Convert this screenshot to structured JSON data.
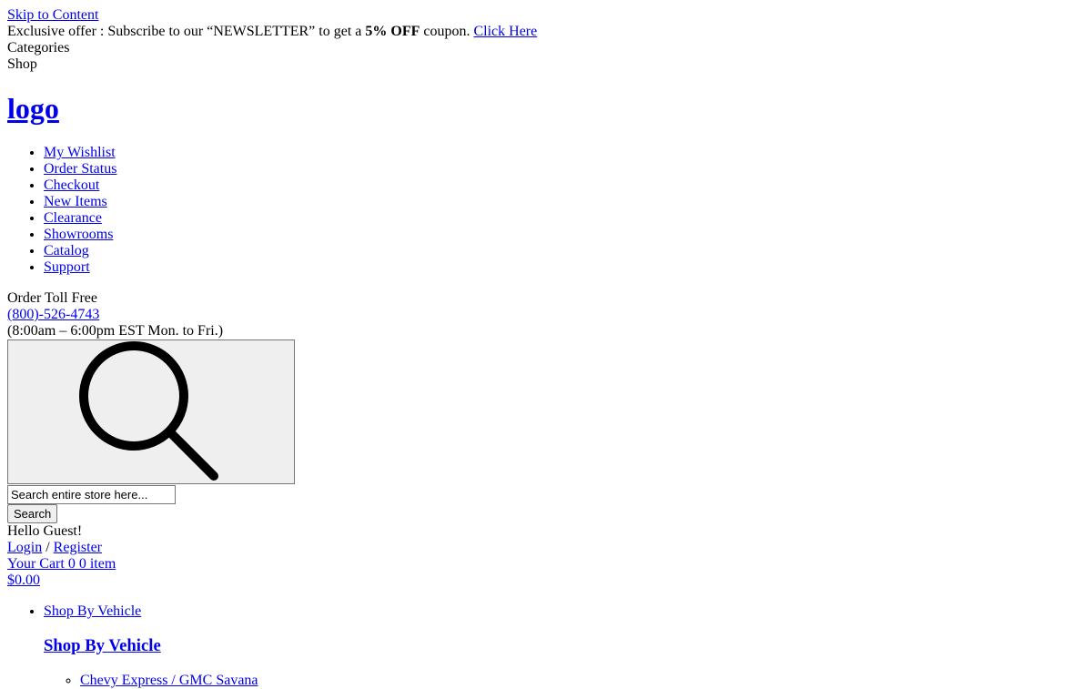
{
  "skip_link": "Skip to Content",
  "promo": {
    "text_before": "Exclusive offer : Subscribe to our “NEWSLETTER” to get a ",
    "highlight": "5% OFF",
    "text_after": " coupon. ",
    "link": "Click Here"
  },
  "categories_label": "Categories",
  "shop_label": "Shop",
  "logo_text": "logo ",
  "top_links": [
    "My Wishlist",
    "Order Status",
    "Checkout",
    "New Items",
    "Clearance",
    "Showrooms",
    "Catalog",
    "Support"
  ],
  "contact": {
    "label": "Order Toll Free",
    "phone": "(800)-526-4743",
    "hours": "(8:00am – 6:00pm EST Mon. to Fri.)"
  },
  "search": {
    "placeholder": "Search entire store here...",
    "button_label": "Search",
    "toggle_icon": "search-icon"
  },
  "account": {
    "greeting": "Hello Guest!",
    "login": "Login",
    "separator": " / ",
    "register": "Register"
  },
  "cart": {
    "label": "Your Cart",
    "count": "0",
    "items_text": "0 item",
    "total": "$0.00"
  },
  "menu": {
    "top_item": "Shop By Vehicle",
    "heading": "Shop By Vehicle",
    "sub_items": [
      "Chevy Express / GMC Savana"
    ]
  },
  "colors": {
    "link": "#0000ee",
    "button_bg": "#efefef",
    "button_border": "#767676"
  }
}
